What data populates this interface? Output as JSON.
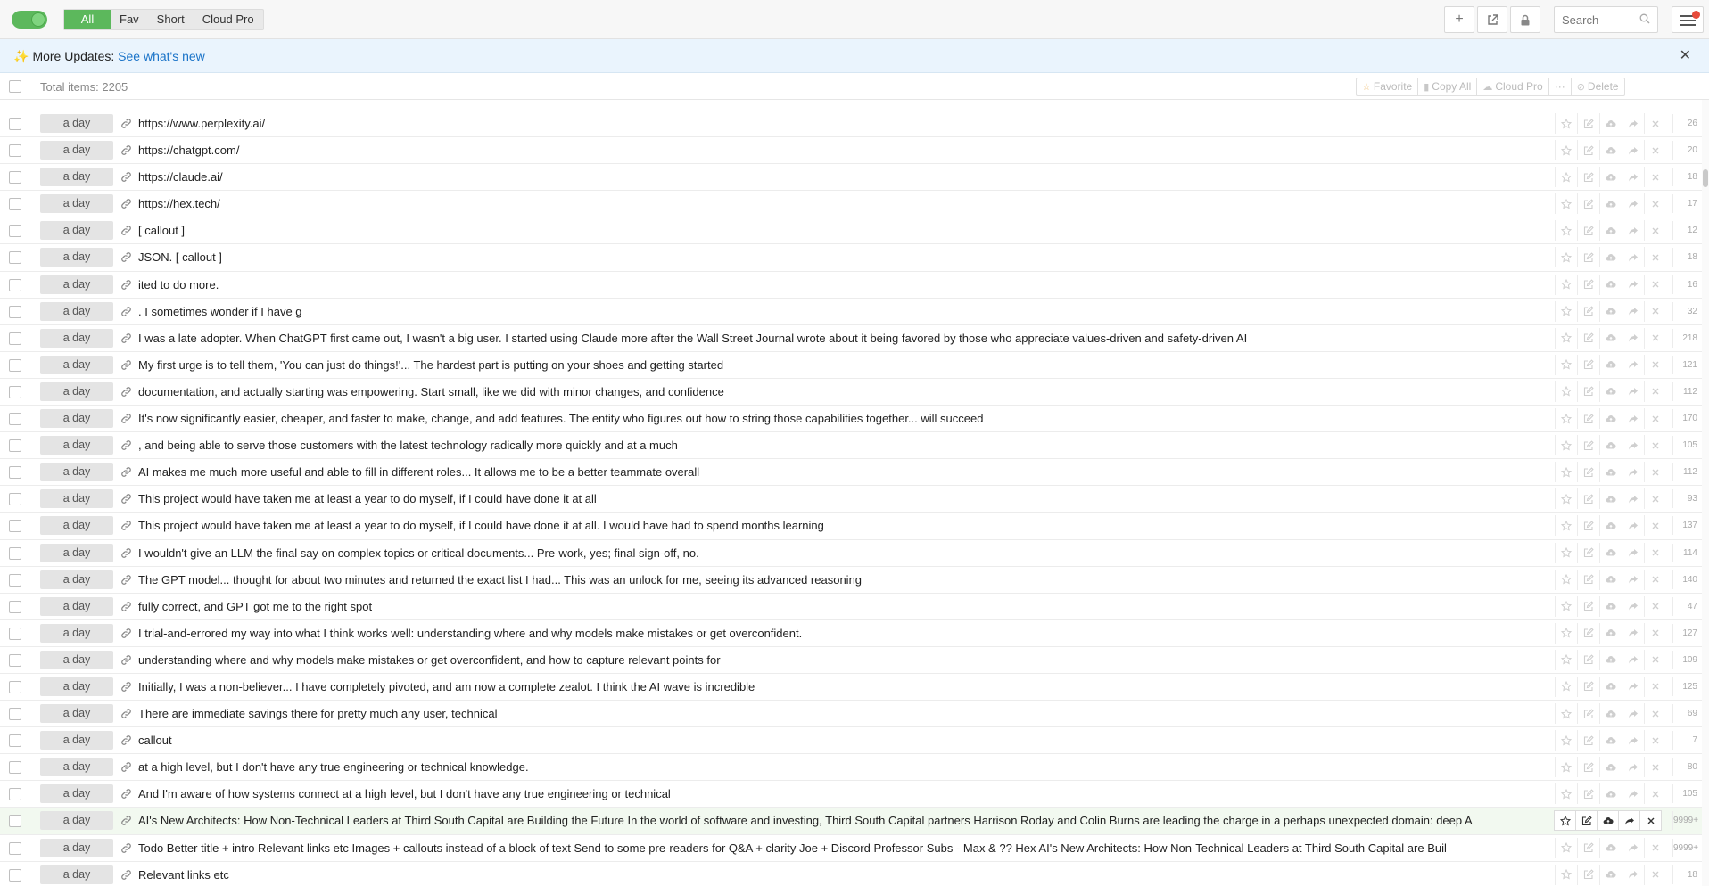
{
  "toolbar": {
    "filter_tabs": [
      "All",
      "Fav",
      "Short",
      "Cloud Pro"
    ],
    "active_tab": "All",
    "add_icon": "plus-icon",
    "open_icon": "external-link-icon",
    "lock_icon": "lock-icon",
    "search_placeholder": "Search",
    "menu_icon": "hamburger-menu-icon",
    "accent_color": "#5cb85c",
    "notification_color": "#e74c3c"
  },
  "banner": {
    "icon": "sparkles-icon",
    "prefix": "More Updates:",
    "link_label": "See what's new",
    "close_icon": "close-icon"
  },
  "header": {
    "total_label": "Total items: 2205",
    "favorite_label": "Favorite",
    "copy_all_label": "Copy All",
    "cloud_pro_label": "Cloud Pro",
    "more_label": "···",
    "delete_label": "Delete"
  },
  "rows": [
    {
      "age": "a day",
      "text": "https://www.perplexity.ai/",
      "count": "26"
    },
    {
      "age": "a day",
      "text": "https://chatgpt.com/",
      "count": "20"
    },
    {
      "age": "a day",
      "text": "https://claude.ai/",
      "count": "18"
    },
    {
      "age": "a day",
      "text": "https://hex.tech/",
      "count": "17"
    },
    {
      "age": "a day",
      "text": "[ callout ]",
      "count": "12"
    },
    {
      "age": "a day",
      "text": "JSON. [ callout ]",
      "count": "18"
    },
    {
      "age": "a day",
      "text": "ited to do more.",
      "count": "16"
    },
    {
      "age": "a day",
      "text": ". I sometimes wonder if I have g",
      "count": "32"
    },
    {
      "age": "a day",
      "text": "I was a late adopter. When ChatGPT first came out, I wasn't a big user. I started using Claude more after the Wall Street Journal wrote about it being favored by those who appreciate values-driven and safety-driven AI",
      "count": "218"
    },
    {
      "age": "a day",
      "text": "My first urge is to tell them, 'You can just do things!'... The hardest part is putting on your shoes and getting started",
      "count": "121"
    },
    {
      "age": "a day",
      "text": "documentation, and actually starting was empowering. Start small, like we did with minor changes, and confidence",
      "count": "112"
    },
    {
      "age": "a day",
      "text": "It's now significantly easier, cheaper, and faster to make, change, and add features. The entity who figures out how to string those capabilities together... will succeed",
      "count": "170"
    },
    {
      "age": "a day",
      "text": ", and being able to serve those customers with the latest technology radically more quickly and at a much",
      "count": "105"
    },
    {
      "age": "a day",
      "text": "AI makes me much more useful and able to fill in different roles... It allows me to be a better teammate overall",
      "count": "112"
    },
    {
      "age": "a day",
      "text": "This project would have taken me at least a year to do myself, if I could have done it at all",
      "count": "93"
    },
    {
      "age": "a day",
      "text": "This project would have taken me at least a year to do myself, if I could have done it at all. I would have had to spend months learning",
      "count": "137"
    },
    {
      "age": "a day",
      "text": "I wouldn't give an LLM the final say on complex topics or critical documents... Pre-work, yes; final sign-off, no.",
      "count": "114"
    },
    {
      "age": "a day",
      "text": "The GPT model... thought for about two minutes and returned the exact list I had... This was an unlock for me, seeing its advanced reasoning",
      "count": "140"
    },
    {
      "age": "a day",
      "text": "fully correct, and GPT got me to the right spot",
      "count": "47"
    },
    {
      "age": "a day",
      "text": "I trial-and-errored my way into what I think works well: understanding where and why models make mistakes or get overconfident.",
      "count": "127"
    },
    {
      "age": "a day",
      "text": "understanding where and why models make mistakes or get overconfident, and how to capture relevant points for",
      "count": "109"
    },
    {
      "age": "a day",
      "text": "Initially, I was a non-believer... I have completely pivoted, and am now a complete zealot. I think the AI wave is incredible",
      "count": "125"
    },
    {
      "age": "a day",
      "text": "There are immediate savings there for pretty much any user, technical",
      "count": "69"
    },
    {
      "age": "a day",
      "text": "callout",
      "count": "7"
    },
    {
      "age": "a day",
      "text": "at a high level, but I don't have any true engineering or technical knowledge.",
      "count": "80"
    },
    {
      "age": "a day",
      "text": "And I'm aware of how systems connect at a high level, but I don't have any true engineering or technical",
      "count": "105"
    },
    {
      "age": "a day",
      "text": "AI's New Architects: How Non-Technical Leaders at Third South Capital are Building the Future In the world of software and investing, Third South Capital partners Harrison Roday and Colin Burns are leading the charge in a perhaps unexpected domain: deep A",
      "count": "9999+",
      "highlight": true
    },
    {
      "age": "a day",
      "text": "Todo Better title + intro Relevant links etc Images + callouts instead of a block of text Send to some pre-readers for Q&A + clarity Joe + Discord Professor Subs - Max & ?? Hex AI's New Architects: How Non-Technical Leaders at Third South Capital are Buil",
      "count": "9999+"
    },
    {
      "age": "a day",
      "text": "Relevant links etc",
      "count": "18"
    }
  ]
}
